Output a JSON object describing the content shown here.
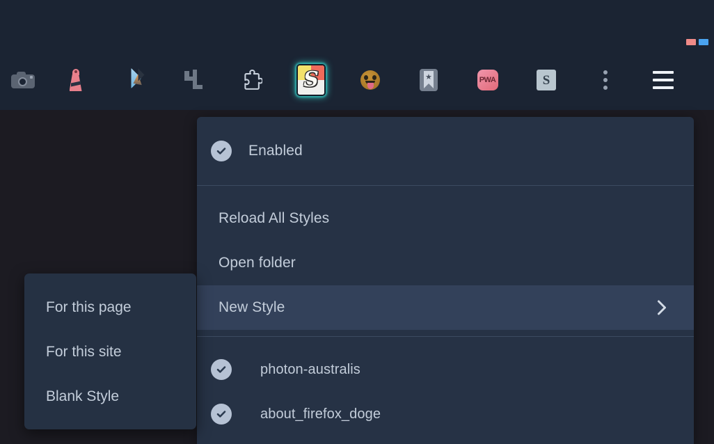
{
  "window": {
    "background": "#1c1b22",
    "chrome_background": "#1b2433"
  },
  "tab_indicator": {
    "colors": [
      "#f08b88",
      "#4aa3f0"
    ]
  },
  "toolbar": {
    "buttons": [
      {
        "name": "screenshot-camera-icon",
        "label": "Screenshot",
        "icon": "camera-icon"
      },
      {
        "name": "lighthouse-icon",
        "label": "Lighthouse",
        "icon": "lighthouse-icon"
      },
      {
        "name": "marker-pencil-icon",
        "label": "Marker",
        "icon": "pencil-icon"
      },
      {
        "name": "ruler-tool-icon",
        "label": "Tool",
        "icon": "four-l-glyph-icon",
        "glyph": "4L"
      },
      {
        "name": "extension-puzzle-icon",
        "label": "Extensions",
        "icon": "puzzle-icon"
      },
      {
        "name": "stylus-icon",
        "label": "Stylus",
        "icon": "stylus-app-icon",
        "glyph": "S",
        "active": true
      },
      {
        "name": "emoji-tongue-icon",
        "label": "Emoji",
        "icon": "emoji-tongue-icon"
      },
      {
        "name": "bookmark-icon",
        "label": "Bookmark",
        "icon": "bookmark-star-icon"
      },
      {
        "name": "pwa-icon",
        "label": "PWA",
        "icon": "pwa-icon",
        "glyph": "PWA"
      },
      {
        "name": "stylish-s-icon",
        "label": "Stylish",
        "icon": "s-square-icon",
        "glyph": "S"
      },
      {
        "name": "overflow-menu-icon",
        "label": "More tools",
        "icon": "kebab-menu-icon"
      },
      {
        "name": "app-menu-icon",
        "label": "Open application menu",
        "icon": "hamburger-menu-icon"
      }
    ]
  },
  "menu": {
    "enabled_item": "Enabled",
    "items": [
      "Reload All Styles",
      "Open folder"
    ],
    "new_style": {
      "label": "New Style",
      "chevron": "chevron-right-icon",
      "highlighted": true
    },
    "styles": [
      {
        "name": "photon-australis",
        "checked": true
      },
      {
        "name": "about_firefox_doge",
        "checked": true
      }
    ],
    "highlight_color": "#33415a",
    "panel_color": "#263245",
    "text_color": "#c3cdda"
  },
  "submenu": {
    "items": [
      "For this page",
      "For this site",
      "Blank Style"
    ],
    "panel_color": "#253143"
  }
}
